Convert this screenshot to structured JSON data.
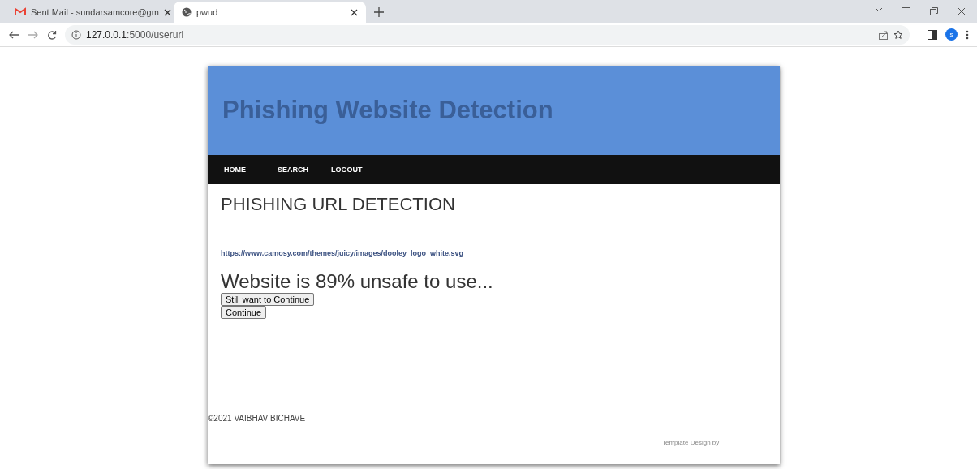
{
  "browser": {
    "tabs": [
      {
        "title": "Sent Mail - sundarsamcore@gm",
        "kind": "mail",
        "selected": false
      },
      {
        "title": "pwud",
        "kind": "globe",
        "selected": true
      }
    ],
    "address": {
      "host": "127.0.0.1",
      "path": ":5000/userurl"
    },
    "profile": "s"
  },
  "site": {
    "title": "Phishing Website Detection",
    "nav": [
      {
        "label": "HOME"
      },
      {
        "label": "SEARCH"
      },
      {
        "label": "LOGOUT"
      }
    ],
    "heading": "PHISHING URL DETECTION",
    "url": "https://www.camosy.com/themes/juicy/images/dooley_logo_white.svg",
    "result": "Website is 89% unsafe to use...",
    "buttons": [
      "Still want to Continue",
      "Continue"
    ],
    "footer": "©2021 VAIBHAV BICHAVE"
  },
  "credit": "Template Design by"
}
